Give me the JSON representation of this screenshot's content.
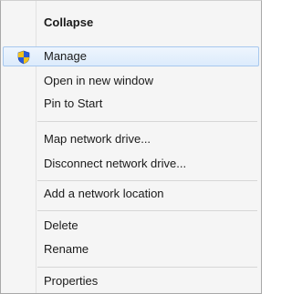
{
  "context_menu": {
    "items": [
      {
        "label": "Collapse",
        "bold": true
      },
      {
        "label": "Manage",
        "icon": "uac-shield-icon",
        "highlighted": true
      },
      {
        "label": "Open in new window"
      },
      {
        "label": "Pin to Start"
      },
      {
        "label": "Map network drive..."
      },
      {
        "label": "Disconnect network drive..."
      },
      {
        "label": "Add a network location"
      },
      {
        "label": "Delete"
      },
      {
        "label": "Rename"
      },
      {
        "label": "Properties"
      }
    ],
    "colors": {
      "background": "#f5f5f5",
      "highlight_fill": "#dcebfc",
      "highlight_border": "#a7c8ee",
      "separator": "#d6d6d6",
      "shield_blue": "#2a5bd7",
      "shield_yellow": "#f2c21b"
    }
  }
}
